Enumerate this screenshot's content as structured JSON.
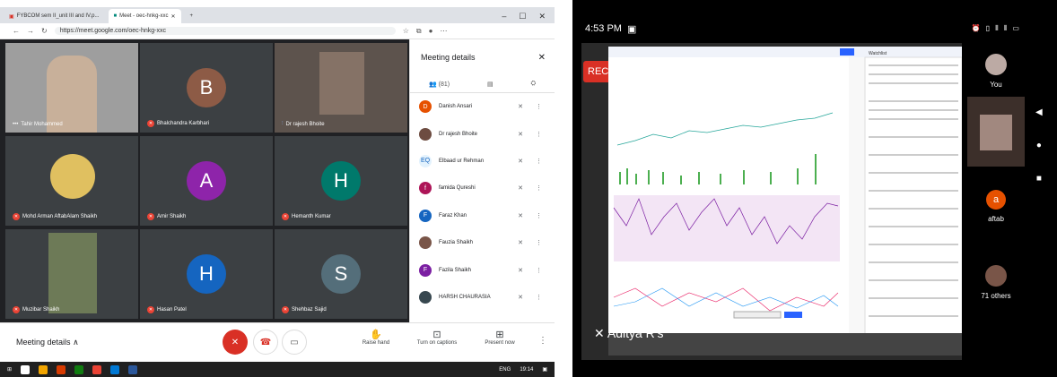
{
  "browser": {
    "tabs": [
      {
        "label": "FYBCOM sem II_unit III and IV.p..."
      },
      {
        "label": "Meet - oec-hnkg-xxc"
      }
    ],
    "url": "https://meet.google.com/oec-hnkg-xxc",
    "window_controls": [
      "–",
      "☐",
      "✕"
    ]
  },
  "meet": {
    "tiles": [
      {
        "name": "Tahir Mohammed"
      },
      {
        "name": "Bhalchandra Karbhari",
        "initial": "B"
      },
      {
        "name": "Dr rajesh Bhoite"
      },
      {
        "name": "Mohd Arman AftabAlam Shaikh"
      },
      {
        "name": "Amir Shaikh",
        "initial": "A"
      },
      {
        "name": "Hemanth Kumar",
        "initial": "H"
      },
      {
        "name": "Muzibar Shaikh"
      },
      {
        "name": "Hasan Patel",
        "initial": "H"
      },
      {
        "name": "Shehbaz Sajid",
        "initial": "S"
      }
    ],
    "colors": {
      "B": "#8d5b46",
      "A_purple": "#8e24aa",
      "H_teal": "#00796b",
      "H_blue": "#1565c0",
      "S_gray": "#546e7a"
    }
  },
  "details": {
    "title": "Meeting details",
    "tabs": {
      "people_count": "(81)"
    },
    "participants": [
      {
        "name": "Danish Ansari",
        "initial": "D",
        "color": "#e65100"
      },
      {
        "name": "Dr rajesh Bhoite",
        "initial": "",
        "color": "#6d4c41"
      },
      {
        "name": "Elbaad ur Rehman",
        "initial": "EQ",
        "color": "#e3f2fd"
      },
      {
        "name": "famida Qureshi",
        "initial": "f",
        "color": "#ad1457"
      },
      {
        "name": "Faraz Khan",
        "initial": "F",
        "color": "#1565c0"
      },
      {
        "name": "Fauzia Shaikh",
        "initial": "",
        "color": "#795548"
      },
      {
        "name": "Fazila Shaikh",
        "initial": "F",
        "color": "#7b1fa2"
      },
      {
        "name": "HARSH CHAURASIA",
        "initial": "",
        "color": "#37474f"
      }
    ]
  },
  "controls": {
    "meeting_details": "Meeting details",
    "raise_hand": "Raise hand",
    "captions": "Turn on captions",
    "present": "Present now"
  },
  "taskbar": {
    "lang": "ENG",
    "time": "19:14"
  },
  "phone": {
    "time": "4:53 PM",
    "rec": "REC",
    "presenter": "Aditya R's",
    "participants": [
      {
        "label": "You"
      },
      {
        "label": ""
      },
      {
        "label": "aftab",
        "initial": "a"
      },
      {
        "label": "71 others"
      }
    ],
    "chart_header": {
      "watchlist": "Watchlist",
      "symbol": "NIFTY"
    }
  }
}
